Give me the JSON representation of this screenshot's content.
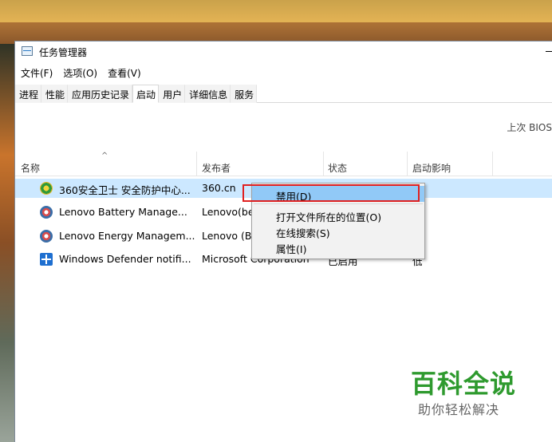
{
  "window": {
    "title": "任务管理器"
  },
  "menubar": {
    "items": [
      {
        "label": "文件(F)"
      },
      {
        "label": "选项(O)"
      },
      {
        "label": "查看(V)"
      }
    ]
  },
  "tabs": [
    {
      "label": "进程",
      "active": false
    },
    {
      "label": "性能",
      "active": false
    },
    {
      "label": "应用历史记录",
      "active": false
    },
    {
      "label": "启动",
      "active": true
    },
    {
      "label": "用户",
      "active": false
    },
    {
      "label": "详细信息",
      "active": false
    },
    {
      "label": "服务",
      "active": false
    }
  ],
  "startup": {
    "last_bios_label": "上次 BIOS",
    "columns": {
      "name": "名称",
      "publisher": "发布者",
      "status": "状态",
      "impact": "启动影响"
    },
    "sort_indicator": "^",
    "rows": [
      {
        "name": "360安全卫士 安全防护中心...",
        "publisher": "360.cn",
        "status": "",
        "impact": "",
        "icon": "360-icon",
        "selected": true
      },
      {
        "name": "Lenovo Battery Manage...",
        "publisher": "Lenovo(be",
        "status": "",
        "impact": "",
        "icon": "lenovo-icon",
        "selected": false
      },
      {
        "name": "Lenovo Energy Managem...",
        "publisher": "Lenovo (B",
        "status": "",
        "impact": "",
        "icon": "lenovo-icon",
        "selected": false
      },
      {
        "name": "Windows Defender notifi...",
        "publisher": "Microsoft Corporation",
        "status": "已启用",
        "impact": "低",
        "icon": "windows-defender-icon",
        "selected": false
      }
    ]
  },
  "context_menu": {
    "items": [
      {
        "label": "禁用(D)",
        "highlighted": true
      },
      {
        "label": "打开文件所在的位置(O)",
        "highlighted": false
      },
      {
        "label": "在线搜索(S)",
        "highlighted": false
      },
      {
        "label": "属性(I)",
        "highlighted": false
      }
    ]
  },
  "watermark": {
    "main": "百科全说",
    "sub": "助你轻松解决"
  },
  "colors": {
    "selected_row": "#cce8ff",
    "menu_highlight": "#91c9f7",
    "annotation_box": "#e02020",
    "watermark_green": "#2e9a2e"
  }
}
